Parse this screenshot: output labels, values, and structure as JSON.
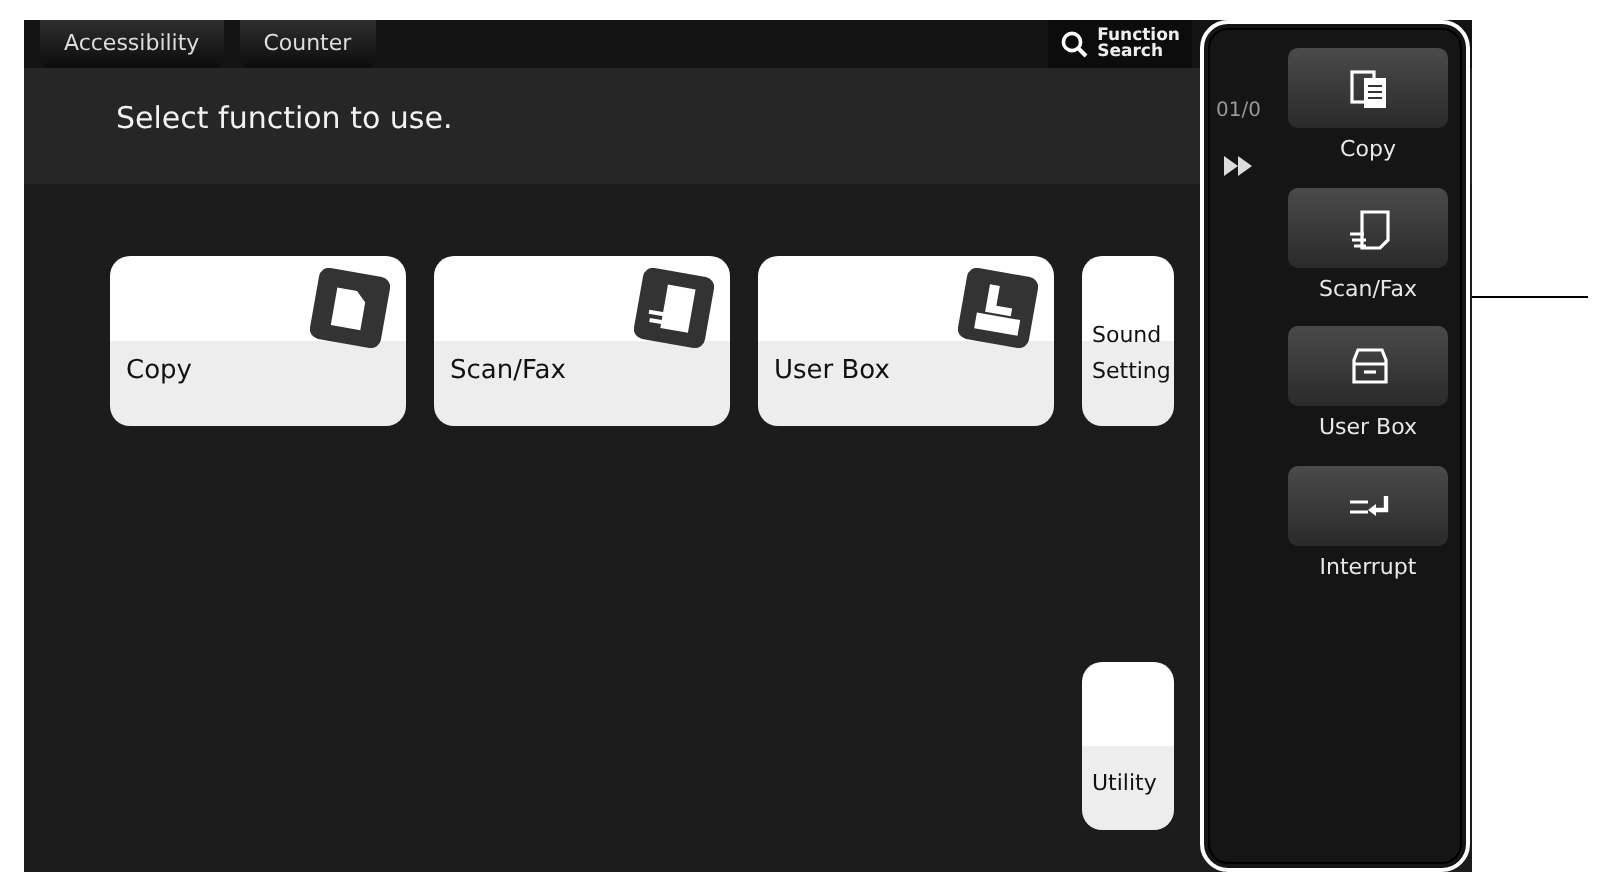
{
  "top_bar": {
    "buttons": [
      "Accessibility",
      "Counter"
    ],
    "search_button": "Function\nSearch"
  },
  "prompt": "Select function to use.",
  "counter_fragment": "01/0",
  "function_tiles": [
    {
      "label": "Copy",
      "kind": "copy"
    },
    {
      "label": "Scan/Fax",
      "kind": "scan"
    },
    {
      "label": "User Box",
      "kind": "box"
    },
    {
      "label": "Sound\nSetting",
      "kind": "none"
    }
  ],
  "utility_tile": {
    "label": "Utility"
  },
  "side_panel": {
    "items": [
      {
        "label": "Copy",
        "kind": "copy"
      },
      {
        "label": "Scan/Fax",
        "kind": "scan"
      },
      {
        "label": "User Box",
        "kind": "box"
      },
      {
        "label": "Interrupt",
        "kind": "interrupt"
      }
    ]
  }
}
